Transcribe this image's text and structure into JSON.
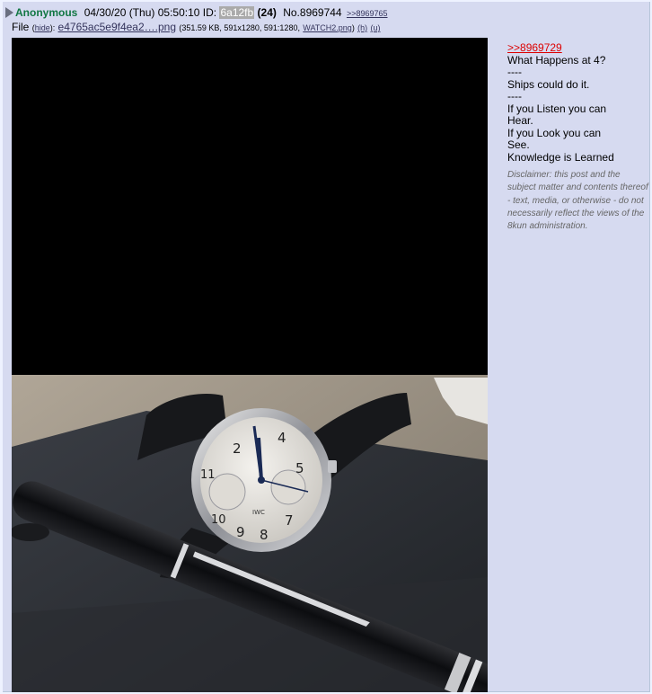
{
  "post": {
    "name": "Anonymous",
    "date": "04/30/20 (Thu) 05:50:10",
    "id_label": "ID:",
    "id_value": "6a12fb",
    "post_count": "(24)",
    "post_no": "No.8969744",
    "backlink": ">>8969765"
  },
  "file": {
    "label": "File",
    "open_paren": "(",
    "hide_label": "hide",
    "close_colon": "):",
    "filename": "e4765ac5e9f4ea2….png",
    "meta_pre": "(351.59 KB, 591x1280, 591:1280,",
    "orig_name": "WATCH2.png",
    "close_paren": ")",
    "h_label": "(h)",
    "u_label": "(u)"
  },
  "body": {
    "quote": ">>8969729",
    "lines": [
      "What Happens at 4?",
      "----",
      "Ships could do it.",
      "----",
      "If you Listen you can Hear.",
      "If you Look you can See.",
      "Knowledge is Learned"
    ],
    "disclaimer": "Disclaimer: this post and the subject matter and contents thereof - text, media, or otherwise - do not necessarily reflect the views of the 8kun administration."
  },
  "image": {
    "watch_numerals": [
      "2",
      "4",
      "5",
      "7",
      "8",
      "9",
      "10",
      "11"
    ],
    "watch_brand": "IWC"
  }
}
